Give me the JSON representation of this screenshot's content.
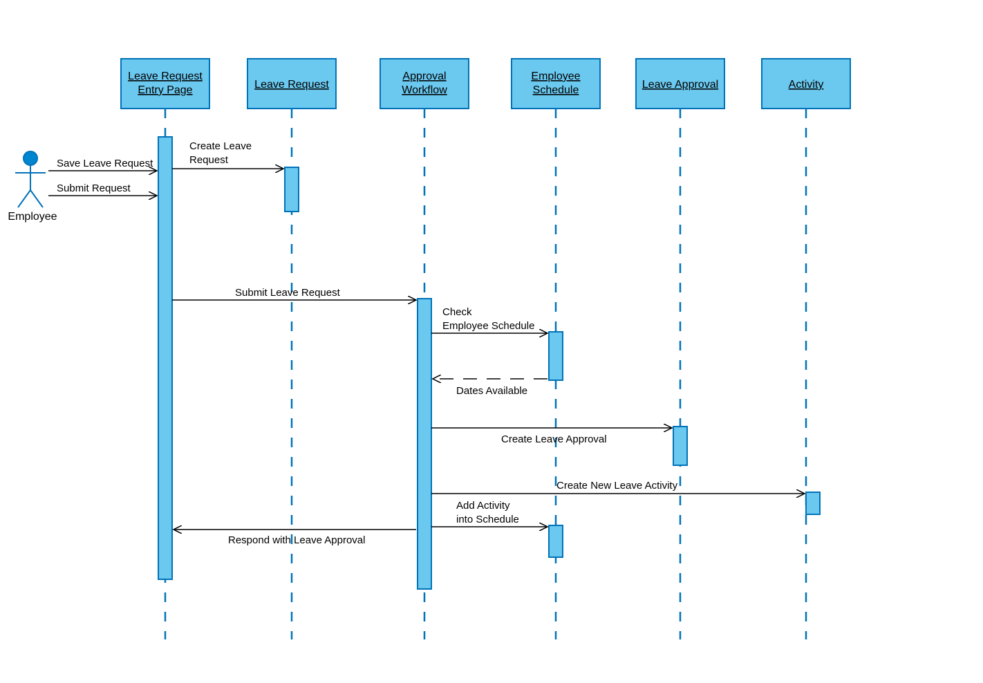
{
  "lanes": {
    "employee": "Employee",
    "entry": {
      "l1": "Leave Request",
      "l2": "Entry Page"
    },
    "request": "Leave Request",
    "workflow": {
      "l1": "Approval",
      "l2": "Workflow"
    },
    "schedule": {
      "l1": "Employee",
      "l2": "Schedule"
    },
    "approval": "Leave Approval",
    "activity": "Activity"
  },
  "messages": {
    "saveLeave": "Save Leave Request",
    "submitReq": "Submit  Request",
    "createLeave": {
      "l1": "Create Leave",
      "l2": "Request"
    },
    "submitLeave": "Submit  Leave Request",
    "checkSched": {
      "l1": "Check",
      "l2": "Employee Schedule"
    },
    "datesAvail": "Dates Available",
    "createApproval": "Create Leave Approval",
    "createActivity": "Create New Leave Activity",
    "addActivity": {
      "l1": "Add Activity",
      "l2": "into Schedule"
    },
    "respond": "Respond with Leave Approval"
  }
}
